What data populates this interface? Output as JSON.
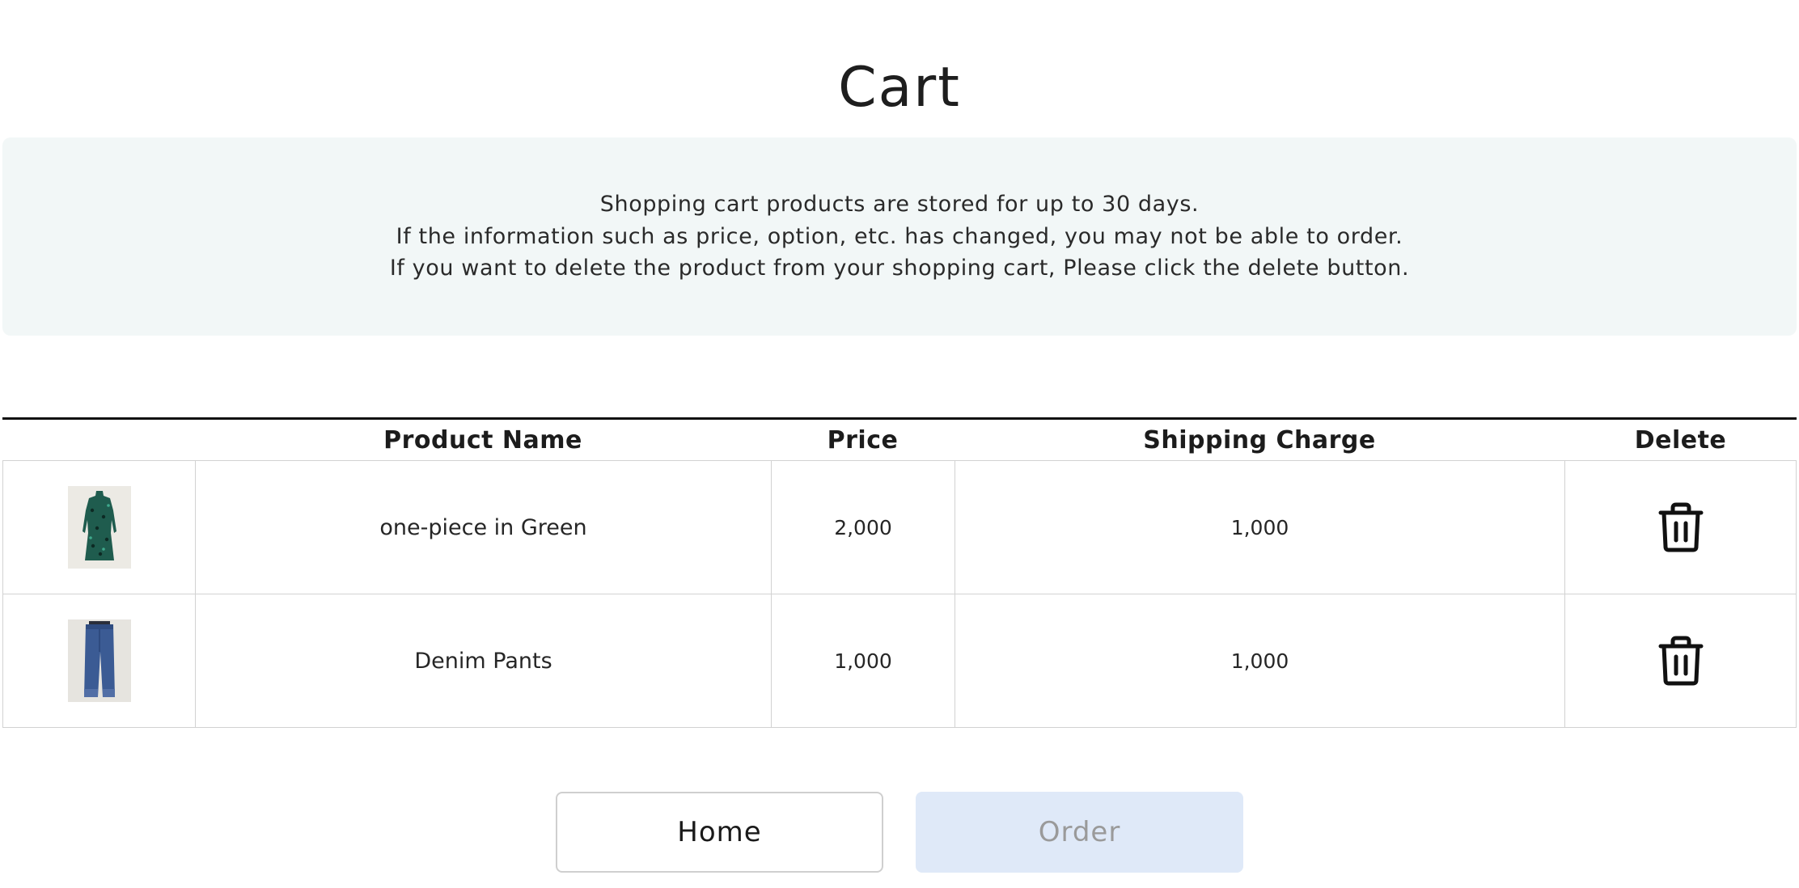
{
  "page": {
    "title": "Cart"
  },
  "notice": {
    "lines": [
      "Shopping cart products are stored for up to 30 days.",
      "If the information such as price, option, etc. has changed, you may not be able to order.",
      "If you want to delete the product from your shopping cart, Please click the delete button."
    ],
    "background": "#f2f7f7"
  },
  "table": {
    "headers": {
      "image": "",
      "product_name": "Product Name",
      "price": "Price",
      "shipping_charge": "Shipping Charge",
      "delete": "Delete"
    },
    "rows": [
      {
        "image_icon": "green-dress-thumbnail",
        "product_name": "one-piece in Green",
        "price": "2,000",
        "shipping_charge": "1,000",
        "delete_icon": "trash-icon"
      },
      {
        "image_icon": "denim-pants-thumbnail",
        "product_name": "Denim Pants",
        "price": "1,000",
        "shipping_charge": "1,000",
        "delete_icon": "trash-icon"
      }
    ]
  },
  "buttons": {
    "home_label": "Home",
    "order_label": "Order",
    "order_background": "#dfe9f8"
  }
}
